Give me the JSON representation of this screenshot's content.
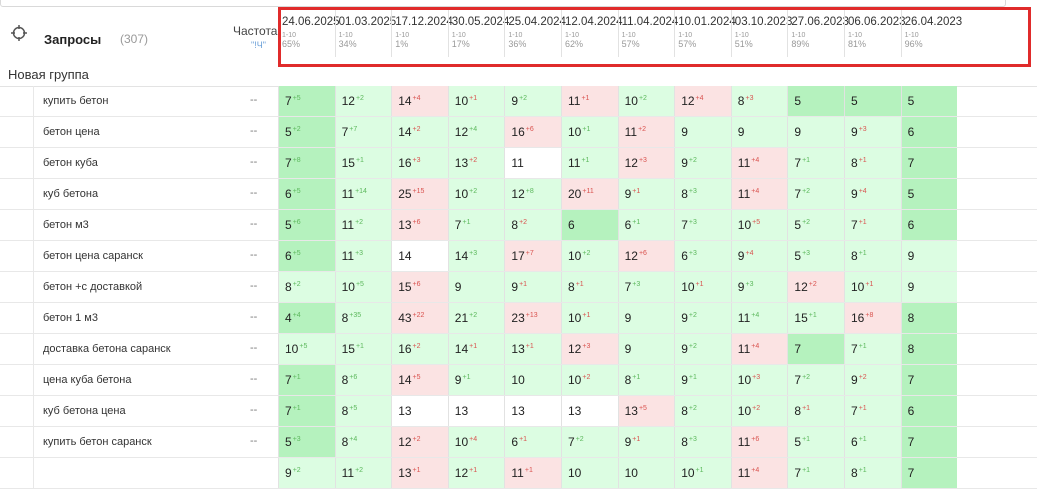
{
  "header": {
    "queries_title": "Запросы",
    "queries_count": "(307)",
    "freq_title": "Частота",
    "freq_sub": "\"!Ч\""
  },
  "group": {
    "label": "Новая группа"
  },
  "dates": [
    {
      "date": "24.06.2025",
      "range": "1-10",
      "pct": "65%"
    },
    {
      "date": "01.03.2025",
      "range": "1-10",
      "pct": "34%"
    },
    {
      "date": "17.12.2024",
      "range": "1-10",
      "pct": "1%"
    },
    {
      "date": "30.05.2024",
      "range": "1-10",
      "pct": "17%"
    },
    {
      "date": "25.04.2024",
      "range": "1-10",
      "pct": "36%"
    },
    {
      "date": "12.04.2024",
      "range": "1-10",
      "pct": "62%"
    },
    {
      "date": "11.04.2024",
      "range": "1-10",
      "pct": "57%"
    },
    {
      "date": "10.01.2024",
      "range": "1-10",
      "pct": "57%"
    },
    {
      "date": "03.10.2023",
      "range": "1-10",
      "pct": "51%"
    },
    {
      "date": "27.06.2023",
      "range": "1-10",
      "pct": "89%"
    },
    {
      "date": "06.06.2023",
      "range": "1-10",
      "pct": "81%"
    },
    {
      "date": "26.04.2023",
      "range": "1-10",
      "pct": "96%"
    }
  ],
  "rows": [
    {
      "keyword": "купить бетон",
      "freq": "--",
      "cells": [
        {
          "v": "7",
          "c": "+5",
          "d": "up",
          "bg": "g"
        },
        {
          "v": "12",
          "c": "+2",
          "d": "up",
          "bg": "lg"
        },
        {
          "v": "14",
          "c": "+4",
          "d": "down",
          "bg": "r"
        },
        {
          "v": "10",
          "c": "+1",
          "d": "down",
          "bg": "lg"
        },
        {
          "v": "9",
          "c": "+2",
          "d": "up",
          "bg": "lg"
        },
        {
          "v": "11",
          "c": "+1",
          "d": "down",
          "bg": "r"
        },
        {
          "v": "10",
          "c": "+2",
          "d": "up",
          "bg": "lg"
        },
        {
          "v": "12",
          "c": "+4",
          "d": "down",
          "bg": "r"
        },
        {
          "v": "8",
          "c": "+3",
          "d": "down",
          "bg": "lg"
        },
        {
          "v": "5",
          "c": "",
          "d": "",
          "bg": "g"
        },
        {
          "v": "5",
          "c": "",
          "d": "",
          "bg": "g"
        },
        {
          "v": "5",
          "c": "",
          "d": "",
          "bg": "g"
        }
      ]
    },
    {
      "keyword": "бетон цена",
      "freq": "--",
      "cells": [
        {
          "v": "5",
          "c": "+2",
          "d": "up",
          "bg": "g"
        },
        {
          "v": "7",
          "c": "+7",
          "d": "up",
          "bg": "lg"
        },
        {
          "v": "14",
          "c": "+2",
          "d": "down",
          "bg": "lg"
        },
        {
          "v": "12",
          "c": "+4",
          "d": "up",
          "bg": "lg"
        },
        {
          "v": "16",
          "c": "+6",
          "d": "down",
          "bg": "r"
        },
        {
          "v": "10",
          "c": "+1",
          "d": "up",
          "bg": "lg"
        },
        {
          "v": "11",
          "c": "+2",
          "d": "down",
          "bg": "r"
        },
        {
          "v": "9",
          "c": "",
          "d": "",
          "bg": "lg"
        },
        {
          "v": "9",
          "c": "",
          "d": "",
          "bg": "lg"
        },
        {
          "v": "9",
          "c": "",
          "d": "",
          "bg": "lg"
        },
        {
          "v": "9",
          "c": "+3",
          "d": "down",
          "bg": "lg"
        },
        {
          "v": "6",
          "c": "",
          "d": "",
          "bg": "g"
        }
      ]
    },
    {
      "keyword": "бетон куба",
      "freq": "--",
      "cells": [
        {
          "v": "7",
          "c": "+8",
          "d": "up",
          "bg": "g"
        },
        {
          "v": "15",
          "c": "+1",
          "d": "up",
          "bg": "lg"
        },
        {
          "v": "16",
          "c": "+3",
          "d": "down",
          "bg": "lg"
        },
        {
          "v": "13",
          "c": "+2",
          "d": "down",
          "bg": "lg"
        },
        {
          "v": "11",
          "c": "",
          "d": "",
          "bg": "w"
        },
        {
          "v": "11",
          "c": "+1",
          "d": "up",
          "bg": "lg"
        },
        {
          "v": "12",
          "c": "+3",
          "d": "down",
          "bg": "r"
        },
        {
          "v": "9",
          "c": "+2",
          "d": "up",
          "bg": "lg"
        },
        {
          "v": "11",
          "c": "+4",
          "d": "down",
          "bg": "r"
        },
        {
          "v": "7",
          "c": "+1",
          "d": "up",
          "bg": "lg"
        },
        {
          "v": "8",
          "c": "+1",
          "d": "down",
          "bg": "lg"
        },
        {
          "v": "7",
          "c": "",
          "d": "",
          "bg": "g"
        }
      ]
    },
    {
      "keyword": "куб бетона",
      "freq": "--",
      "cells": [
        {
          "v": "6",
          "c": "+5",
          "d": "up",
          "bg": "g"
        },
        {
          "v": "11",
          "c": "+14",
          "d": "up",
          "bg": "lg"
        },
        {
          "v": "25",
          "c": "+15",
          "d": "down",
          "bg": "r"
        },
        {
          "v": "10",
          "c": "+2",
          "d": "up",
          "bg": "lg"
        },
        {
          "v": "12",
          "c": "+8",
          "d": "up",
          "bg": "lg"
        },
        {
          "v": "20",
          "c": "+11",
          "d": "down",
          "bg": "r"
        },
        {
          "v": "9",
          "c": "+1",
          "d": "down",
          "bg": "lg"
        },
        {
          "v": "8",
          "c": "+3",
          "d": "up",
          "bg": "lg"
        },
        {
          "v": "11",
          "c": "+4",
          "d": "down",
          "bg": "r"
        },
        {
          "v": "7",
          "c": "+2",
          "d": "up",
          "bg": "lg"
        },
        {
          "v": "9",
          "c": "+4",
          "d": "down",
          "bg": "lg"
        },
        {
          "v": "5",
          "c": "",
          "d": "",
          "bg": "g"
        }
      ]
    },
    {
      "keyword": "бетон м3",
      "freq": "--",
      "cells": [
        {
          "v": "5",
          "c": "+6",
          "d": "up",
          "bg": "g"
        },
        {
          "v": "11",
          "c": "+2",
          "d": "up",
          "bg": "lg"
        },
        {
          "v": "13",
          "c": "+6",
          "d": "down",
          "bg": "r"
        },
        {
          "v": "7",
          "c": "+1",
          "d": "up",
          "bg": "lg"
        },
        {
          "v": "8",
          "c": "+2",
          "d": "down",
          "bg": "lg"
        },
        {
          "v": "6",
          "c": "",
          "d": "",
          "bg": "g"
        },
        {
          "v": "6",
          "c": "+1",
          "d": "up",
          "bg": "lg"
        },
        {
          "v": "7",
          "c": "+3",
          "d": "up",
          "bg": "lg"
        },
        {
          "v": "10",
          "c": "+5",
          "d": "down",
          "bg": "lg"
        },
        {
          "v": "5",
          "c": "+2",
          "d": "up",
          "bg": "lg"
        },
        {
          "v": "7",
          "c": "+1",
          "d": "down",
          "bg": "lg"
        },
        {
          "v": "6",
          "c": "",
          "d": "",
          "bg": "g"
        }
      ]
    },
    {
      "keyword": "бетон цена саранск",
      "freq": "--",
      "cells": [
        {
          "v": "6",
          "c": "+5",
          "d": "up",
          "bg": "g"
        },
        {
          "v": "11",
          "c": "+3",
          "d": "up",
          "bg": "lg"
        },
        {
          "v": "14",
          "c": "",
          "d": "",
          "bg": "w"
        },
        {
          "v": "14",
          "c": "+3",
          "d": "up",
          "bg": "lg"
        },
        {
          "v": "17",
          "c": "+7",
          "d": "down",
          "bg": "r"
        },
        {
          "v": "10",
          "c": "+2",
          "d": "up",
          "bg": "lg"
        },
        {
          "v": "12",
          "c": "+6",
          "d": "down",
          "bg": "r"
        },
        {
          "v": "6",
          "c": "+3",
          "d": "up",
          "bg": "lg"
        },
        {
          "v": "9",
          "c": "+4",
          "d": "down",
          "bg": "lg"
        },
        {
          "v": "5",
          "c": "+3",
          "d": "up",
          "bg": "lg"
        },
        {
          "v": "8",
          "c": "+1",
          "d": "up",
          "bg": "lg"
        },
        {
          "v": "9",
          "c": "",
          "d": "",
          "bg": "lg"
        }
      ]
    },
    {
      "keyword": "бетон +с доставкой",
      "freq": "--",
      "cells": [
        {
          "v": "8",
          "c": "+2",
          "d": "up",
          "bg": "lg"
        },
        {
          "v": "10",
          "c": "+5",
          "d": "up",
          "bg": "lg"
        },
        {
          "v": "15",
          "c": "+6",
          "d": "down",
          "bg": "r"
        },
        {
          "v": "9",
          "c": "",
          "d": "",
          "bg": "lg"
        },
        {
          "v": "9",
          "c": "+1",
          "d": "down",
          "bg": "lg"
        },
        {
          "v": "8",
          "c": "+1",
          "d": "down",
          "bg": "lg"
        },
        {
          "v": "7",
          "c": "+3",
          "d": "up",
          "bg": "lg"
        },
        {
          "v": "10",
          "c": "+1",
          "d": "down",
          "bg": "lg"
        },
        {
          "v": "9",
          "c": "+3",
          "d": "up",
          "bg": "lg"
        },
        {
          "v": "12",
          "c": "+2",
          "d": "down",
          "bg": "r"
        },
        {
          "v": "10",
          "c": "+1",
          "d": "down",
          "bg": "lg"
        },
        {
          "v": "9",
          "c": "",
          "d": "",
          "bg": "lg"
        }
      ]
    },
    {
      "keyword": "бетон 1 м3",
      "freq": "--",
      "cells": [
        {
          "v": "4",
          "c": "+4",
          "d": "up",
          "bg": "g"
        },
        {
          "v": "8",
          "c": "+35",
          "d": "up",
          "bg": "lg"
        },
        {
          "v": "43",
          "c": "+22",
          "d": "down",
          "bg": "r"
        },
        {
          "v": "21",
          "c": "+2",
          "d": "up",
          "bg": "lg"
        },
        {
          "v": "23",
          "c": "+13",
          "d": "down",
          "bg": "r"
        },
        {
          "v": "10",
          "c": "+1",
          "d": "down",
          "bg": "lg"
        },
        {
          "v": "9",
          "c": "",
          "d": "",
          "bg": "lg"
        },
        {
          "v": "9",
          "c": "+2",
          "d": "up",
          "bg": "lg"
        },
        {
          "v": "11",
          "c": "+4",
          "d": "up",
          "bg": "lg"
        },
        {
          "v": "15",
          "c": "+1",
          "d": "up",
          "bg": "lg"
        },
        {
          "v": "16",
          "c": "+8",
          "d": "down",
          "bg": "r"
        },
        {
          "v": "8",
          "c": "",
          "d": "",
          "bg": "g"
        }
      ]
    },
    {
      "keyword": "доставка бетона саранск",
      "freq": "--",
      "cells": [
        {
          "v": "10",
          "c": "+5",
          "d": "up",
          "bg": "lg"
        },
        {
          "v": "15",
          "c": "+1",
          "d": "up",
          "bg": "lg"
        },
        {
          "v": "16",
          "c": "+2",
          "d": "down",
          "bg": "lg"
        },
        {
          "v": "14",
          "c": "+1",
          "d": "down",
          "bg": "lg"
        },
        {
          "v": "13",
          "c": "+1",
          "d": "down",
          "bg": "lg"
        },
        {
          "v": "12",
          "c": "+3",
          "d": "down",
          "bg": "r"
        },
        {
          "v": "9",
          "c": "",
          "d": "",
          "bg": "lg"
        },
        {
          "v": "9",
          "c": "+2",
          "d": "up",
          "bg": "lg"
        },
        {
          "v": "11",
          "c": "+4",
          "d": "down",
          "bg": "r"
        },
        {
          "v": "7",
          "c": "",
          "d": "",
          "bg": "g"
        },
        {
          "v": "7",
          "c": "+1",
          "d": "up",
          "bg": "lg"
        },
        {
          "v": "8",
          "c": "",
          "d": "",
          "bg": "g"
        }
      ]
    },
    {
      "keyword": "цена куба бетона",
      "freq": "--",
      "cells": [
        {
          "v": "7",
          "c": "+1",
          "d": "up",
          "bg": "g"
        },
        {
          "v": "8",
          "c": "+6",
          "d": "up",
          "bg": "lg"
        },
        {
          "v": "14",
          "c": "+5",
          "d": "down",
          "bg": "r"
        },
        {
          "v": "9",
          "c": "+1",
          "d": "up",
          "bg": "lg"
        },
        {
          "v": "10",
          "c": "",
          "d": "",
          "bg": "lg"
        },
        {
          "v": "10",
          "c": "+2",
          "d": "down",
          "bg": "lg"
        },
        {
          "v": "8",
          "c": "+1",
          "d": "up",
          "bg": "lg"
        },
        {
          "v": "9",
          "c": "+1",
          "d": "up",
          "bg": "lg"
        },
        {
          "v": "10",
          "c": "+3",
          "d": "down",
          "bg": "lg"
        },
        {
          "v": "7",
          "c": "+2",
          "d": "up",
          "bg": "lg"
        },
        {
          "v": "9",
          "c": "+2",
          "d": "down",
          "bg": "lg"
        },
        {
          "v": "7",
          "c": "",
          "d": "",
          "bg": "g"
        }
      ]
    },
    {
      "keyword": "куб бетона цена",
      "freq": "--",
      "cells": [
        {
          "v": "7",
          "c": "+1",
          "d": "up",
          "bg": "g"
        },
        {
          "v": "8",
          "c": "+5",
          "d": "up",
          "bg": "lg"
        },
        {
          "v": "13",
          "c": "",
          "d": "",
          "bg": "w"
        },
        {
          "v": "13",
          "c": "",
          "d": "",
          "bg": "w"
        },
        {
          "v": "13",
          "c": "",
          "d": "",
          "bg": "w"
        },
        {
          "v": "13",
          "c": "",
          "d": "",
          "bg": "w"
        },
        {
          "v": "13",
          "c": "+5",
          "d": "down",
          "bg": "r"
        },
        {
          "v": "8",
          "c": "+2",
          "d": "up",
          "bg": "lg"
        },
        {
          "v": "10",
          "c": "+2",
          "d": "down",
          "bg": "lg"
        },
        {
          "v": "8",
          "c": "+1",
          "d": "down",
          "bg": "lg"
        },
        {
          "v": "7",
          "c": "+1",
          "d": "down",
          "bg": "lg"
        },
        {
          "v": "6",
          "c": "",
          "d": "",
          "bg": "g"
        }
      ]
    },
    {
      "keyword": "купить бетон саранск",
      "freq": "--",
      "cells": [
        {
          "v": "5",
          "c": "+3",
          "d": "up",
          "bg": "g"
        },
        {
          "v": "8",
          "c": "+4",
          "d": "up",
          "bg": "lg"
        },
        {
          "v": "12",
          "c": "+2",
          "d": "down",
          "bg": "r"
        },
        {
          "v": "10",
          "c": "+4",
          "d": "down",
          "bg": "lg"
        },
        {
          "v": "6",
          "c": "+1",
          "d": "down",
          "bg": "lg"
        },
        {
          "v": "7",
          "c": "+2",
          "d": "up",
          "bg": "lg"
        },
        {
          "v": "9",
          "c": "+1",
          "d": "down",
          "bg": "lg"
        },
        {
          "v": "8",
          "c": "+3",
          "d": "up",
          "bg": "lg"
        },
        {
          "v": "11",
          "c": "+6",
          "d": "down",
          "bg": "r"
        },
        {
          "v": "5",
          "c": "+1",
          "d": "up",
          "bg": "lg"
        },
        {
          "v": "6",
          "c": "+1",
          "d": "up",
          "bg": "lg"
        },
        {
          "v": "7",
          "c": "",
          "d": "",
          "bg": "g"
        }
      ]
    },
    {
      "keyword": "",
      "freq": "",
      "cells": [
        {
          "v": "9",
          "c": "+2",
          "d": "up",
          "bg": "lg"
        },
        {
          "v": "11",
          "c": "+2",
          "d": "up",
          "bg": "lg"
        },
        {
          "v": "13",
          "c": "+1",
          "d": "down",
          "bg": "r"
        },
        {
          "v": "12",
          "c": "+1",
          "d": "down",
          "bg": "lg"
        },
        {
          "v": "11",
          "c": "+1",
          "d": "down",
          "bg": "r"
        },
        {
          "v": "10",
          "c": "",
          "d": "",
          "bg": "lg"
        },
        {
          "v": "10",
          "c": "",
          "d": "",
          "bg": "lg"
        },
        {
          "v": "10",
          "c": "+1",
          "d": "up",
          "bg": "lg"
        },
        {
          "v": "11",
          "c": "+4",
          "d": "down",
          "bg": "r"
        },
        {
          "v": "7",
          "c": "+1",
          "d": "up",
          "bg": "lg"
        },
        {
          "v": "8",
          "c": "+1",
          "d": "up",
          "bg": "lg"
        },
        {
          "v": "7",
          "c": "",
          "d": "",
          "bg": "g"
        }
      ]
    }
  ]
}
